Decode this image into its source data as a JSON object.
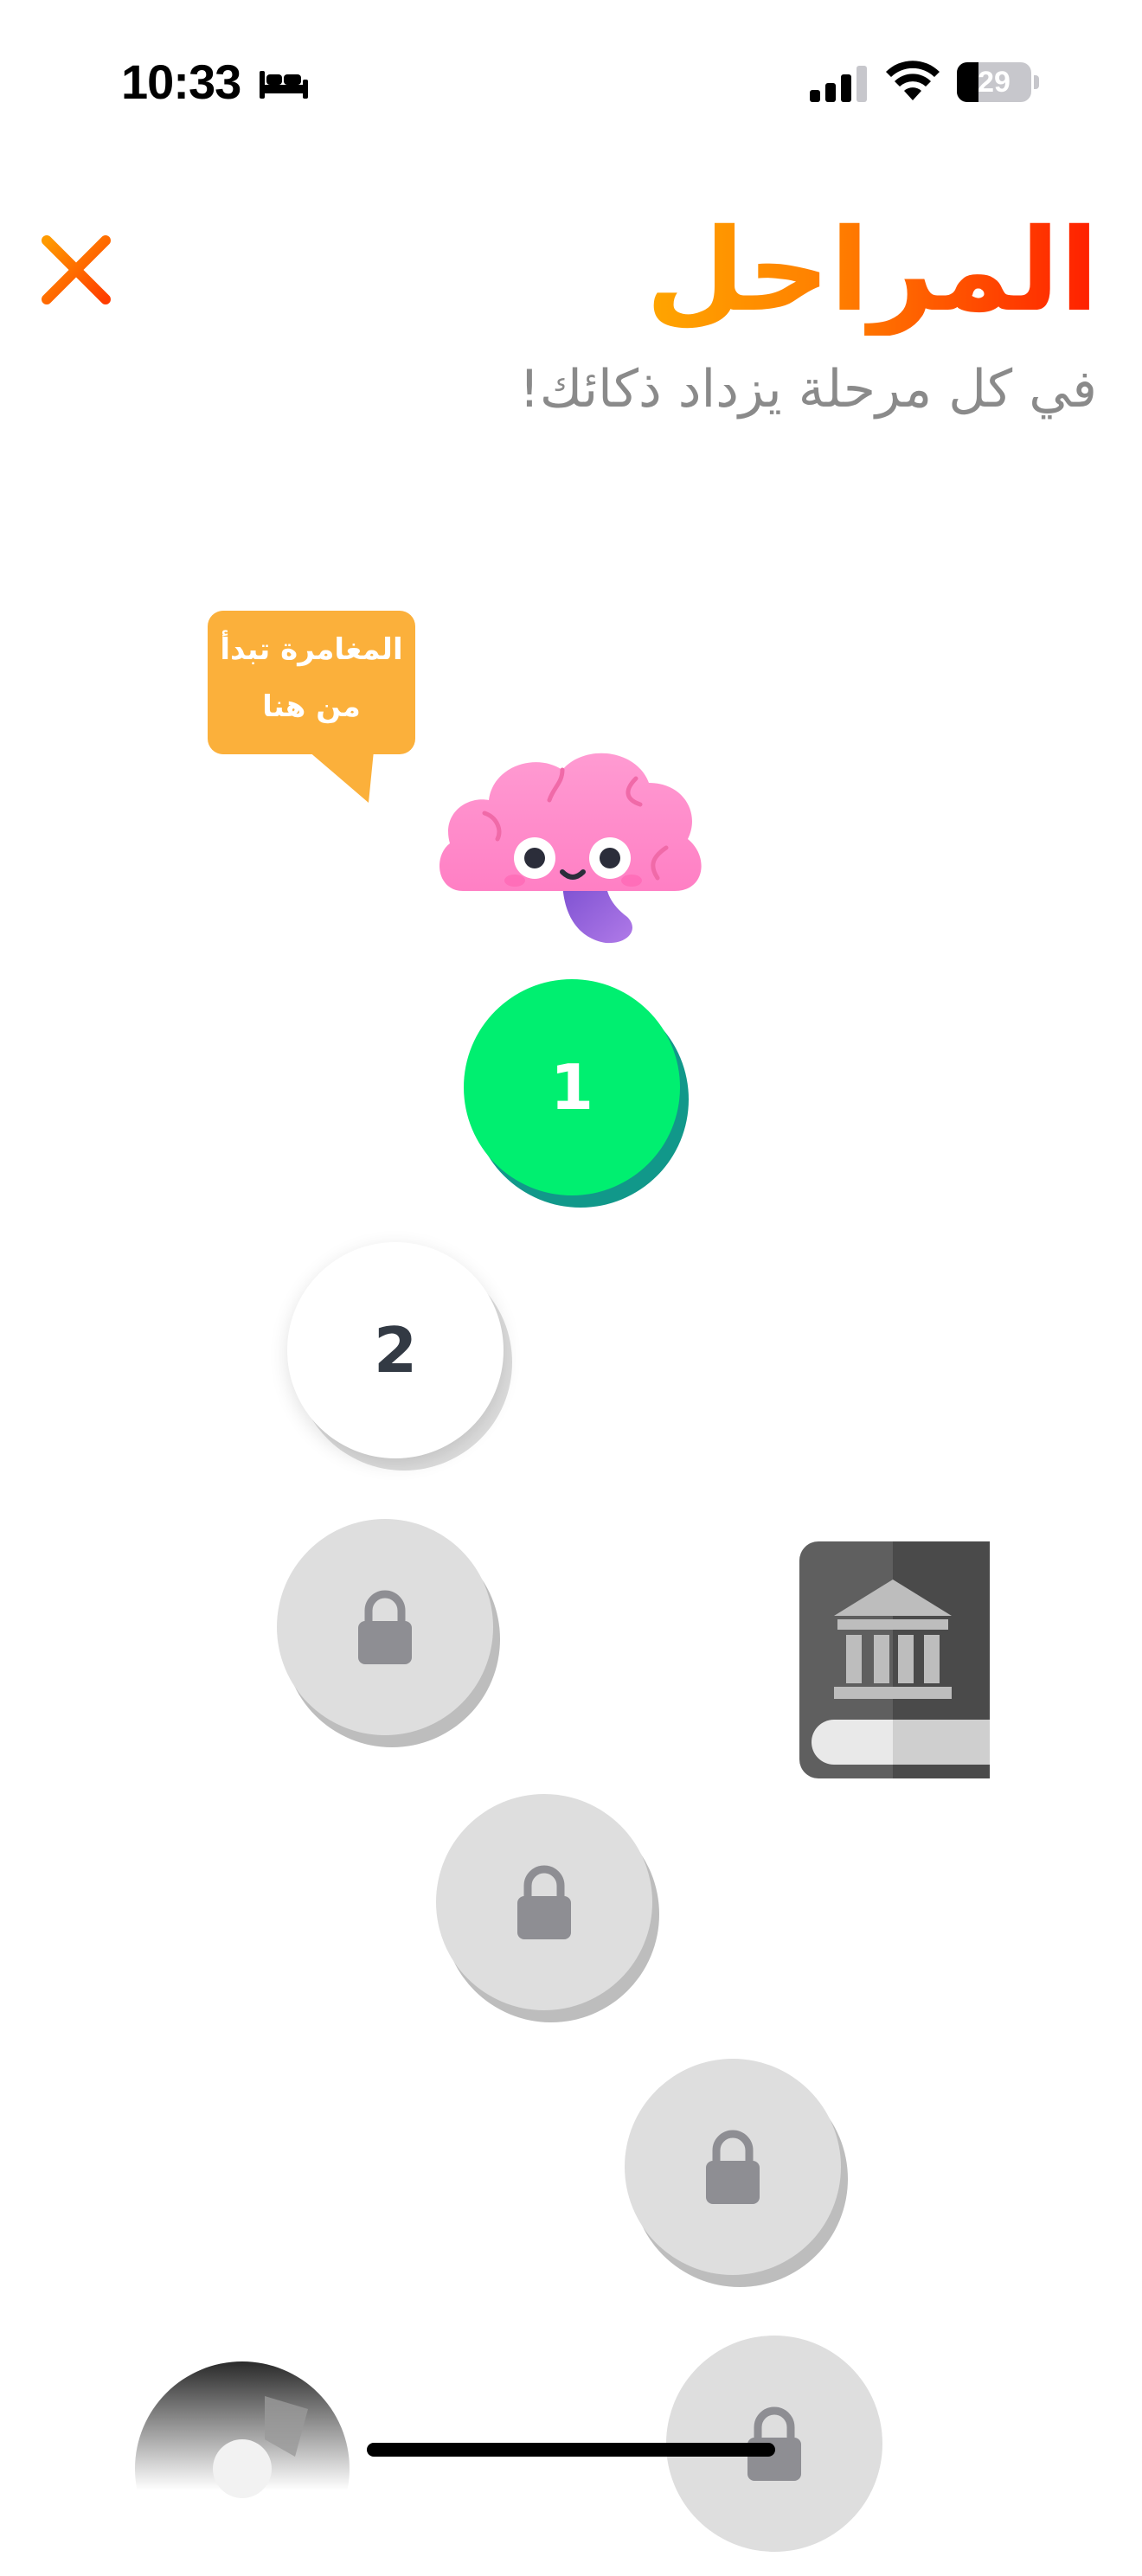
{
  "status_bar": {
    "time": "10:33",
    "battery": "29",
    "battery_level": 0.29,
    "icons": [
      "bed-icon",
      "cellular-signal-icon",
      "wifi-icon",
      "battery-icon"
    ]
  },
  "header": {
    "title": "المراحل",
    "subtitle": "في كل مرحلة يزداد ذكائك!",
    "close_icon": "close-icon"
  },
  "tooltip": {
    "line1": "المغامرة تبدأ",
    "line2": "من هنا"
  },
  "mascot": {
    "icon": "brain-mascot-icon"
  },
  "levels": [
    {
      "label": "1",
      "state": "current"
    },
    {
      "label": "2",
      "state": "unlocked"
    },
    {
      "label": "",
      "state": "locked",
      "icon": "lock-icon"
    },
    {
      "label": "",
      "state": "locked",
      "icon": "lock-icon"
    },
    {
      "label": "",
      "state": "locked",
      "icon": "lock-icon"
    },
    {
      "label": "",
      "state": "locked",
      "icon": "lock-icon"
    }
  ],
  "side_items": [
    {
      "icon": "museum-book-icon"
    },
    {
      "icon": "disc-icon"
    }
  ],
  "colors": {
    "title_gradient": [
      "#ffa600",
      "#ff1e00"
    ],
    "close": "#ff7a00",
    "current_level": "#00ef70",
    "current_level_shadow": "#11988a",
    "tooltip": "#fbb03b",
    "locked": "#dedede"
  }
}
